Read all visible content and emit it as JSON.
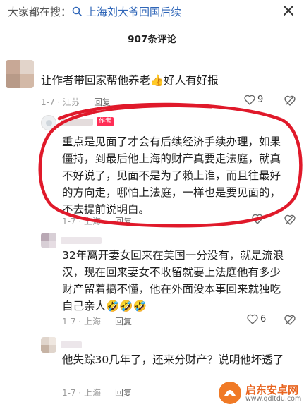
{
  "search": {
    "prefix": "大家都在搜：",
    "query": "上海刘大爷回国后续"
  },
  "comment_count": "907条评论",
  "comments": [
    {
      "text": "让作者带回家帮他养老👍好人有好报",
      "date": "1-7 · 江苏",
      "reply": "回复",
      "likes": "9"
    },
    {
      "author_tag": "作者",
      "text_lines": [
        "重点是见面了才会有后续经济手续办理，如果",
        "僵持，到最后他上海的财产真要走法庭，就真",
        "不好说了，见面不是为了赖上谁，而且往最好",
        "的方向走，哪怕上法庭，一样也是要见面的，",
        "不去提前说明白。"
      ],
      "date": "1-7 · 上海",
      "reply": "回复",
      "likes": ""
    },
    {
      "text_lines": [
        "32年离开妻女回来在美国一分没有，就是流浪",
        "汉，现在回来妻女不收留就要上法庭他有多少",
        "财产留着搞不懂，他在外面没本事回来就独吃",
        "自己亲人🤣🤣🤣"
      ],
      "date": "1-7 · 上海",
      "reply": "回复",
      "likes": "6"
    },
    {
      "text": "他失踪30几年了，还来分财产？说明他坏透了",
      "date": "1-7 · 上海",
      "reply": "回复"
    }
  ],
  "watermark": {
    "title": "启东安卓网",
    "url": "www.qdltdu.com"
  },
  "colors": {
    "query": "#2f66b8",
    "author_tag": "#ff2d55",
    "circle": "#e0192a"
  }
}
